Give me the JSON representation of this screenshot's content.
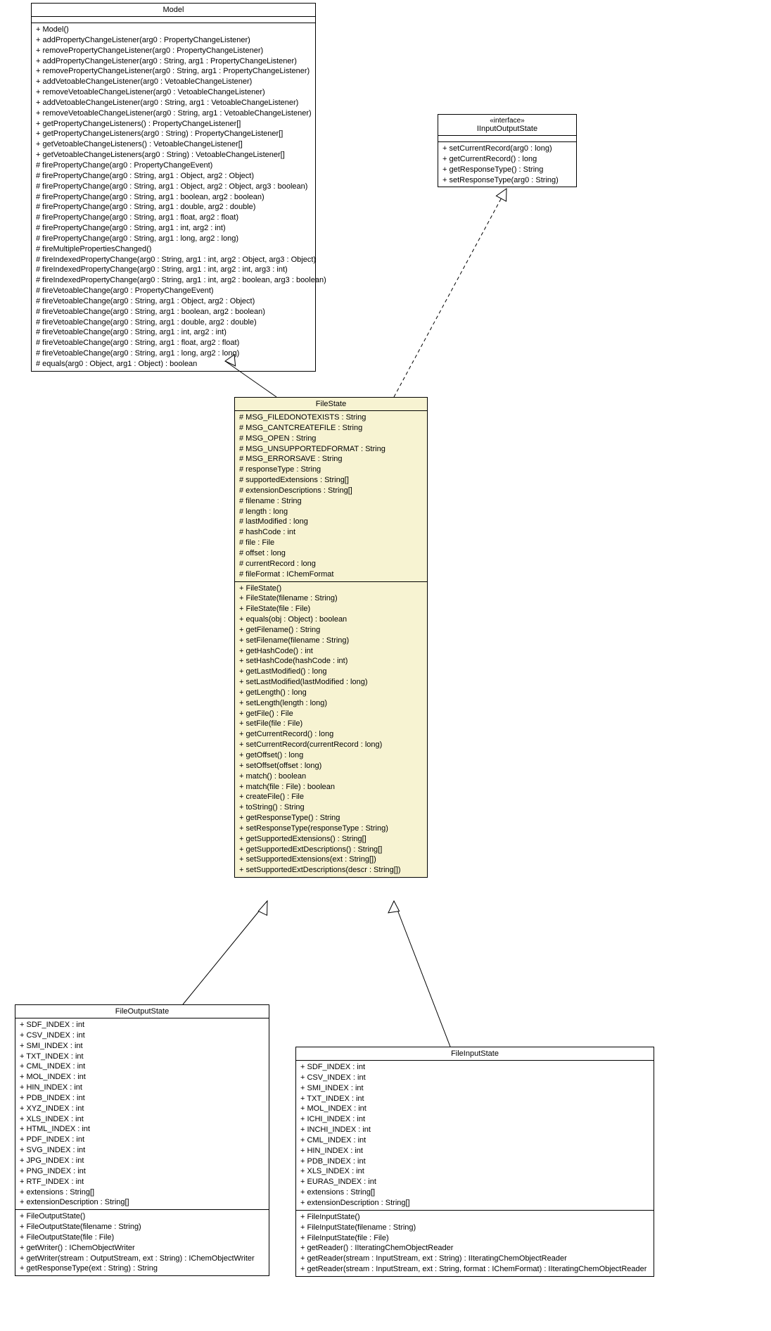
{
  "classes": {
    "model": {
      "name": "Model",
      "attributes": [],
      "operations": [
        "+ Model()",
        "+ addPropertyChangeListener(arg0 : PropertyChangeListener)",
        "+ removePropertyChangeListener(arg0 : PropertyChangeListener)",
        "+ addPropertyChangeListener(arg0 : String, arg1 : PropertyChangeListener)",
        "+ removePropertyChangeListener(arg0 : String, arg1 : PropertyChangeListener)",
        "+ addVetoableChangeListener(arg0 : VetoableChangeListener)",
        "+ removeVetoableChangeListener(arg0 : VetoableChangeListener)",
        "+ addVetoableChangeListener(arg0 : String, arg1 : VetoableChangeListener)",
        "+ removeVetoableChangeListener(arg0 : String, arg1 : VetoableChangeListener)",
        "+ getPropertyChangeListeners() : PropertyChangeListener[]",
        "+ getPropertyChangeListeners(arg0 : String) : PropertyChangeListener[]",
        "+ getVetoableChangeListeners() : VetoableChangeListener[]",
        "+ getVetoableChangeListeners(arg0 : String) : VetoableChangeListener[]",
        "# firePropertyChange(arg0 : PropertyChangeEvent)",
        "# firePropertyChange(arg0 : String, arg1 : Object, arg2 : Object)",
        "# firePropertyChange(arg0 : String, arg1 : Object, arg2 : Object, arg3 : boolean)",
        "# firePropertyChange(arg0 : String, arg1 : boolean, arg2 : boolean)",
        "# firePropertyChange(arg0 : String, arg1 : double, arg2 : double)",
        "# firePropertyChange(arg0 : String, arg1 : float, arg2 : float)",
        "# firePropertyChange(arg0 : String, arg1 : int, arg2 : int)",
        "# firePropertyChange(arg0 : String, arg1 : long, arg2 : long)",
        "# fireMultiplePropertiesChanged()",
        "# fireIndexedPropertyChange(arg0 : String, arg1 : int, arg2 : Object, arg3 : Object)",
        "# fireIndexedPropertyChange(arg0 : String, arg1 : int, arg2 : int, arg3 : int)",
        "# fireIndexedPropertyChange(arg0 : String, arg1 : int, arg2 : boolean, arg3 : boolean)",
        "# fireVetoableChange(arg0 : PropertyChangeEvent)",
        "# fireVetoableChange(arg0 : String, arg1 : Object, arg2 : Object)",
        "# fireVetoableChange(arg0 : String, arg1 : boolean, arg2 : boolean)",
        "# fireVetoableChange(arg0 : String, arg1 : double, arg2 : double)",
        "# fireVetoableChange(arg0 : String, arg1 : int, arg2 : int)",
        "# fireVetoableChange(arg0 : String, arg1 : float, arg2 : float)",
        "# fireVetoableChange(arg0 : String, arg1 : long, arg2 : long)",
        "# equals(arg0 : Object, arg1 : Object) : boolean"
      ]
    },
    "iinputoutputstate": {
      "stereotype": "«interface»",
      "name": "IInputOutputState",
      "attributes": [],
      "operations": [
        "+ setCurrentRecord(arg0 : long)",
        "+ getCurrentRecord() : long",
        "+ getResponseType() : String",
        "+ setResponseType(arg0 : String)"
      ]
    },
    "filestate": {
      "name": "FileState",
      "attributes": [
        "# MSG_FILEDONOTEXISTS : String",
        "# MSG_CANTCREATEFILE : String",
        "# MSG_OPEN : String",
        "# MSG_UNSUPPORTEDFORMAT : String",
        "# MSG_ERRORSAVE : String",
        "# responseType : String",
        "# supportedExtensions : String[]",
        "# extensionDescriptions : String[]",
        "# filename : String",
        "# length : long",
        "# lastModified : long",
        "# hashCode : int",
        "# file : File",
        "# offset : long",
        "# currentRecord : long",
        "# fileFormat : IChemFormat"
      ],
      "operations": [
        "+ FileState()",
        "+ FileState(filename : String)",
        "+ FileState(file : File)",
        "+ equals(obj : Object) : boolean",
        "+ getFilename() : String",
        "+ setFilename(filename : String)",
        "+ getHashCode() : int",
        "+ setHashCode(hashCode : int)",
        "+ getLastModified() : long",
        "+ setLastModified(lastModified : long)",
        "+ getLength() : long",
        "+ setLength(length : long)",
        "+ getFile() : File",
        "+ setFile(file : File)",
        "+ getCurrentRecord() : long",
        "+ setCurrentRecord(currentRecord : long)",
        "+ getOffset() : long",
        "+ setOffset(offset : long)",
        "+ match() : boolean",
        "+ match(file : File) : boolean",
        "+ createFile() : File",
        "+ toString() : String",
        "+ getResponseType() : String",
        "+ setResponseType(responseType : String)",
        "+ getSupportedExtensions() : String[]",
        "+ getSupportedExtDescriptions() : String[]",
        "+ setSupportedExtensions(ext : String[])",
        "+ setSupportedExtDescriptions(descr : String[])"
      ]
    },
    "fileoutputstate": {
      "name": "FileOutputState",
      "attributes": [
        "+ SDF_INDEX : int",
        "+ CSV_INDEX : int",
        "+ SMI_INDEX : int",
        "+ TXT_INDEX : int",
        "+ CML_INDEX : int",
        "+ MOL_INDEX : int",
        "+ HIN_INDEX : int",
        "+ PDB_INDEX : int",
        "+ XYZ_INDEX : int",
        "+ XLS_INDEX : int",
        "+ HTML_INDEX : int",
        "+ PDF_INDEX : int",
        "+ SVG_INDEX : int",
        "+ JPG_INDEX : int",
        "+ PNG_INDEX : int",
        "+ RTF_INDEX : int",
        "+ extensions : String[]",
        "+ extensionDescription : String[]"
      ],
      "operations": [
        "+ FileOutputState()",
        "+ FileOutputState(filename : String)",
        "+ FileOutputState(file : File)",
        "+ getWriter() : IChemObjectWriter",
        "+ getWriter(stream : OutputStream, ext : String) : IChemObjectWriter",
        "+ getResponseType(ext : String) : String"
      ]
    },
    "fileinputstate": {
      "name": "FileInputState",
      "attributes": [
        "+ SDF_INDEX : int",
        "+ CSV_INDEX : int",
        "+ SMI_INDEX : int",
        "+ TXT_INDEX : int",
        "+ MOL_INDEX : int",
        "+ ICHI_INDEX : int",
        "+ INCHI_INDEX : int",
        "+ CML_INDEX : int",
        "+ HIN_INDEX : int",
        "+ PDB_INDEX : int",
        "+ XLS_INDEX : int",
        "+ EURAS_INDEX : int",
        "+ extensions : String[]",
        "+ extensionDescription : String[]"
      ],
      "operations": [
        "+ FileInputState()",
        "+ FileInputState(filename : String)",
        "+ FileInputState(file : File)",
        "+ getReader() : IIteratingChemObjectReader",
        "+ getReader(stream : InputStream, ext : String) : IIteratingChemObjectReader",
        "+ getReader(stream : InputStream, ext : String, format : IChemFormat) : IIteratingChemObjectReader"
      ]
    }
  },
  "chart_data": {
    "type": "uml_class_diagram",
    "nodes": [
      {
        "id": "Model",
        "kind": "class"
      },
      {
        "id": "IInputOutputState",
        "kind": "interface"
      },
      {
        "id": "FileState",
        "kind": "class"
      },
      {
        "id": "FileOutputState",
        "kind": "class"
      },
      {
        "id": "FileInputState",
        "kind": "class"
      }
    ],
    "edges": [
      {
        "from": "FileState",
        "to": "Model",
        "type": "generalization"
      },
      {
        "from": "FileState",
        "to": "IInputOutputState",
        "type": "realization"
      },
      {
        "from": "FileOutputState",
        "to": "FileState",
        "type": "generalization"
      },
      {
        "from": "FileInputState",
        "to": "FileState",
        "type": "generalization"
      }
    ]
  }
}
